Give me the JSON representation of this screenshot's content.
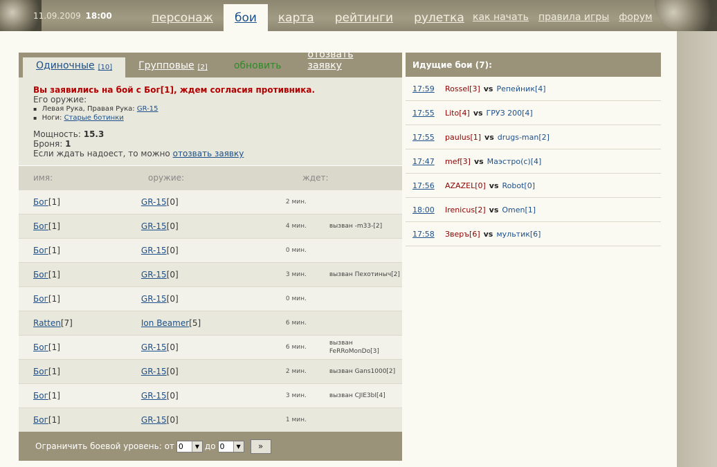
{
  "header": {
    "date": "11.09.2009",
    "time": "18:00",
    "nav": [
      {
        "label": "персонаж"
      },
      {
        "label": "бои"
      },
      {
        "label": "карта"
      },
      {
        "label": "рейтинги"
      },
      {
        "label": "рулетка"
      }
    ],
    "secondary": [
      {
        "label": "как начать"
      },
      {
        "label": "правила игры"
      },
      {
        "label": "форум"
      }
    ]
  },
  "tabs": {
    "single": {
      "label": "Одиночные",
      "count": "[10]"
    },
    "group": {
      "label": "Групповые",
      "count": "[2]"
    },
    "refresh": "обновить",
    "withdraw": "отозвать заявку"
  },
  "notice": {
    "alert": "Вы заявились на бой с Бог[1], ждем согласия противника.",
    "weapon_label": "Его оружие:",
    "hands_label": "Левая Рука, Правая Рука:",
    "hands_value": "GR-15",
    "legs_label": "Ноги:",
    "legs_value": "Старые ботинки",
    "power_label": "Мощность:",
    "power_value": "15.3",
    "armor_label": "Броня:",
    "armor_value": "1",
    "wait_text": "Если ждать надоест, то можно",
    "wait_link": "отозвать заявку"
  },
  "table": {
    "headers": {
      "name": "имя:",
      "weapon": "оружие:",
      "wait": "ждет:"
    },
    "rows": [
      {
        "name": "Бог",
        "level": "[1]",
        "weapon": "GR-15",
        "wlevel": "[0]",
        "wait": "2 мин.",
        "called": ""
      },
      {
        "name": "Бог",
        "level": "[1]",
        "weapon": "GR-15",
        "wlevel": "[0]",
        "wait": "4 мин.",
        "called": "вызван -m33-[2]"
      },
      {
        "name": "Бог",
        "level": "[1]",
        "weapon": "GR-15",
        "wlevel": "[0]",
        "wait": "0 мин.",
        "called": ""
      },
      {
        "name": "Бог",
        "level": "[1]",
        "weapon": "GR-15",
        "wlevel": "[0]",
        "wait": "3 мин.",
        "called": "вызван Пехотиныч[2]"
      },
      {
        "name": "Бог",
        "level": "[1]",
        "weapon": "GR-15",
        "wlevel": "[0]",
        "wait": "0 мин.",
        "called": ""
      },
      {
        "name": "Ratten",
        "level": "[7]",
        "weapon": "Ion Beamer",
        "wlevel": "[5]",
        "wait": "6 мин.",
        "called": ""
      },
      {
        "name": "Бог",
        "level": "[1]",
        "weapon": "GR-15",
        "wlevel": "[0]",
        "wait": "6 мин.",
        "called": "вызван FeRRoMonDo[3]"
      },
      {
        "name": "Бог",
        "level": "[1]",
        "weapon": "GR-15",
        "wlevel": "[0]",
        "wait": "2 мин.",
        "called": "вызван Gans1000[2]"
      },
      {
        "name": "Бог",
        "level": "[1]",
        "weapon": "GR-15",
        "wlevel": "[0]",
        "wait": "3 мин.",
        "called": "вызван СJIE3bI[4]"
      },
      {
        "name": "Бог",
        "level": "[1]",
        "weapon": "GR-15",
        "wlevel": "[0]",
        "wait": "1 мин.",
        "called": ""
      }
    ]
  },
  "filter": {
    "label": "Ограничить боевой уровень: от",
    "from_value": "0",
    "to_label": "до",
    "to_value": "0",
    "go_label": "»"
  },
  "ongoing": {
    "title": "Идущие бои (7):",
    "vs": "vs",
    "fights": [
      {
        "time": "17:59",
        "p1": "Rossel[3]",
        "p2": "Репейник[4]"
      },
      {
        "time": "17:55",
        "p1": "Lito[4]",
        "p2": "ГРУЗ 200[4]"
      },
      {
        "time": "17:55",
        "p1": "paulus[1]",
        "p2": "drugs-man[2]"
      },
      {
        "time": "17:47",
        "p1": "mef[3]",
        "p2": "Маэстро(с)[4]"
      },
      {
        "time": "17:56",
        "p1": "AZAZEL[0]",
        "p2": "Robot[0]"
      },
      {
        "time": "18:00",
        "p1": "Irenicus[2]",
        "p2": "Omen[1]"
      },
      {
        "time": "17:58",
        "p1": "Зверъ[6]",
        "p2": "мультик[6]"
      }
    ]
  }
}
